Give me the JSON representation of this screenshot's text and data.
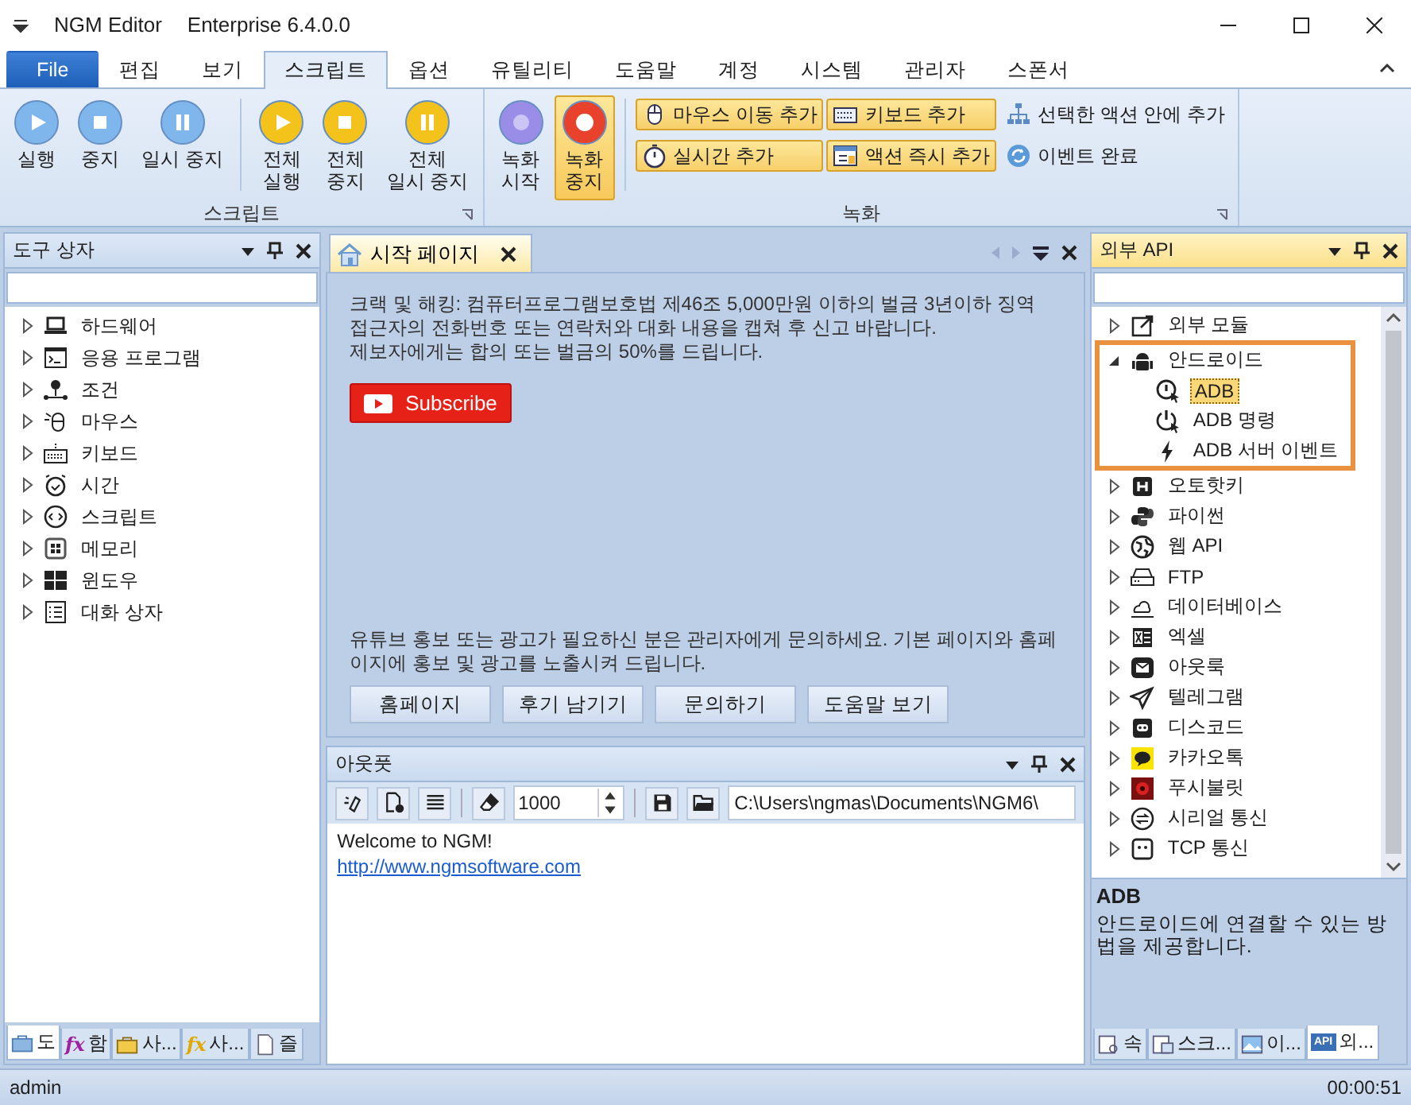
{
  "window": {
    "title": "NGM Editor",
    "edition": "Enterprise 6.4.0.0"
  },
  "ribbon": {
    "tabs": [
      {
        "label": "File",
        "kind": "file",
        "selected": false
      },
      {
        "label": "편집",
        "kind": "tab",
        "selected": false
      },
      {
        "label": "보기",
        "kind": "tab",
        "selected": false
      },
      {
        "label": "스크립트",
        "kind": "tab",
        "selected": true
      },
      {
        "label": "옵션",
        "kind": "tab",
        "selected": false
      },
      {
        "label": "유틸리티",
        "kind": "tab",
        "selected": false
      },
      {
        "label": "도움말",
        "kind": "tab",
        "selected": false
      },
      {
        "label": "계정",
        "kind": "tab",
        "selected": false
      },
      {
        "label": "시스템",
        "kind": "tab",
        "selected": false
      },
      {
        "label": "관리자",
        "kind": "tab",
        "selected": false
      },
      {
        "label": "스폰서",
        "kind": "tab",
        "selected": false
      }
    ],
    "groups": [
      {
        "title": "스크립트",
        "buttons": [
          {
            "label": "실행",
            "kind": "play",
            "color": "#7fb6ec",
            "active": false
          },
          {
            "label": "중지",
            "kind": "stop",
            "color": "#7fb6ec",
            "active": false
          },
          {
            "label": "일시 중지",
            "kind": "pause",
            "color": "#7fb6ec",
            "active": false
          },
          {
            "label": "전체\n실행",
            "kind": "play",
            "color": "#f3c21b",
            "active": false
          },
          {
            "label": "전체\n중지",
            "kind": "stop",
            "color": "#f3c21b",
            "active": false
          },
          {
            "label": "전체\n일시 중지",
            "kind": "pause",
            "color": "#f3c21b",
            "active": false
          }
        ]
      },
      {
        "title": "녹화",
        "buttons": [
          {
            "label": "녹화\n시작",
            "kind": "record-start",
            "color": "#9a8de8",
            "active": false
          },
          {
            "label": "녹화\n중지",
            "kind": "record-stop",
            "color": "#e8412c",
            "active": true
          }
        ],
        "small_buttons": [
          {
            "label": "마우스 이동 추가",
            "highlighted": true
          },
          {
            "label": "키보드 추가",
            "highlighted": true
          },
          {
            "label": "선택한 액션 안에 추가",
            "highlighted": false
          },
          {
            "label": "실시간 추가",
            "highlighted": true
          },
          {
            "label": "액션 즉시 추가",
            "highlighted": true
          },
          {
            "label": "이벤트 완료",
            "highlighted": false
          }
        ]
      }
    ]
  },
  "toolbox": {
    "title": "도구 상자",
    "items": [
      {
        "label": "하드웨어",
        "expanded": false,
        "selected": false
      },
      {
        "label": "응용 프로그램",
        "expanded": false,
        "selected": false
      },
      {
        "label": "조건",
        "expanded": false,
        "selected": false
      },
      {
        "label": "마우스",
        "expanded": false,
        "selected": false
      },
      {
        "label": "키보드",
        "expanded": false,
        "selected": false
      },
      {
        "label": "시간",
        "expanded": false,
        "selected": false
      },
      {
        "label": "스크립트",
        "expanded": false,
        "selected": false
      },
      {
        "label": "메모리",
        "expanded": false,
        "selected": false
      },
      {
        "label": "윈도우",
        "expanded": false,
        "selected": false
      },
      {
        "label": "대화 상자",
        "expanded": false,
        "selected": false
      }
    ],
    "bottom_tabs": [
      {
        "label": "도",
        "selected": true
      },
      {
        "label": "함",
        "icon_text": "fx",
        "selected": false
      },
      {
        "label": "사...",
        "selected": false
      },
      {
        "label": "사...",
        "icon_text": "fx",
        "selected": false
      },
      {
        "label": "즐",
        "selected": false
      }
    ]
  },
  "start_page": {
    "tab": {
      "title": "시작 페이지",
      "selected": true
    },
    "notice": [
      "크랙 및 해킹: 컴퓨터프로그램보호법 제46조 5,000만원 이하의 벌금 3년이하 징역",
      "접근자의 전화번호 또는 연락처와 대화 내용을 캡쳐 후 신고 바랍니다.",
      "제보자에게는 합의 또는 벌금의 50%를 드립니다."
    ],
    "subscribe": "Subscribe",
    "promo": "유튜브 홍보 또는 광고가 필요하신 분은 관리자에게 문의하세요. 기본 페이지와 홈페이지에 홍보 및 광고를 노출시켜 드립니다.",
    "buttons": [
      "홈페이지",
      "후기 남기기",
      "문의하기",
      "도움말 보기"
    ]
  },
  "output": {
    "title": "아웃풋",
    "line_limit": "1000",
    "path": "C:\\Users\\ngmas\\Documents\\NGM6\\",
    "lines": [
      "Welcome to NGM!"
    ],
    "link": "http://www.ngmsoftware.com"
  },
  "external_api": {
    "title": "외부 API",
    "items": [
      {
        "label": "외부 모듈",
        "expanded": false,
        "selected": false,
        "highlighted": false
      },
      {
        "label": "안드로이드",
        "expanded": true,
        "selected": false,
        "highlighted": true,
        "children": [
          {
            "label": "ADB",
            "selected": true
          },
          {
            "label": "ADB 명령",
            "selected": false
          },
          {
            "label": "ADB 서버 이벤트",
            "selected": false
          }
        ]
      },
      {
        "label": "오토핫키",
        "expanded": false,
        "selected": false,
        "highlighted": false
      },
      {
        "label": "파이썬",
        "expanded": false,
        "selected": false,
        "highlighted": false
      },
      {
        "label": "웹 API",
        "expanded": false,
        "selected": false,
        "highlighted": false
      },
      {
        "label": "FTP",
        "expanded": false,
        "selected": false,
        "highlighted": false
      },
      {
        "label": "데이터베이스",
        "expanded": false,
        "selected": false,
        "highlighted": false
      },
      {
        "label": "엑셀",
        "expanded": false,
        "selected": false,
        "highlighted": false
      },
      {
        "label": "아웃룩",
        "expanded": false,
        "selected": false,
        "highlighted": false
      },
      {
        "label": "텔레그램",
        "expanded": false,
        "selected": false,
        "highlighted": false
      },
      {
        "label": "디스코드",
        "expanded": false,
        "selected": false,
        "highlighted": false
      },
      {
        "label": "카카오톡",
        "expanded": false,
        "selected": false,
        "highlighted": false
      },
      {
        "label": "푸시불릿",
        "expanded": false,
        "selected": false,
        "highlighted": false
      },
      {
        "label": "시리얼 통신",
        "expanded": false,
        "selected": false,
        "highlighted": false
      },
      {
        "label": "TCP 통신",
        "expanded": false,
        "selected": false,
        "highlighted": false
      }
    ],
    "description": {
      "title": "ADB",
      "text": "안드로이드에 연결할 수 있는 방법을 제공합니다."
    },
    "bottom_tabs": [
      {
        "label": "속",
        "selected": false
      },
      {
        "label": "스크...",
        "selected": false
      },
      {
        "label": "이...",
        "selected": false
      },
      {
        "label": "외...",
        "icon_text": "API",
        "selected": true
      }
    ]
  },
  "status_bar": {
    "user": "admin",
    "time": "00:00:51"
  }
}
